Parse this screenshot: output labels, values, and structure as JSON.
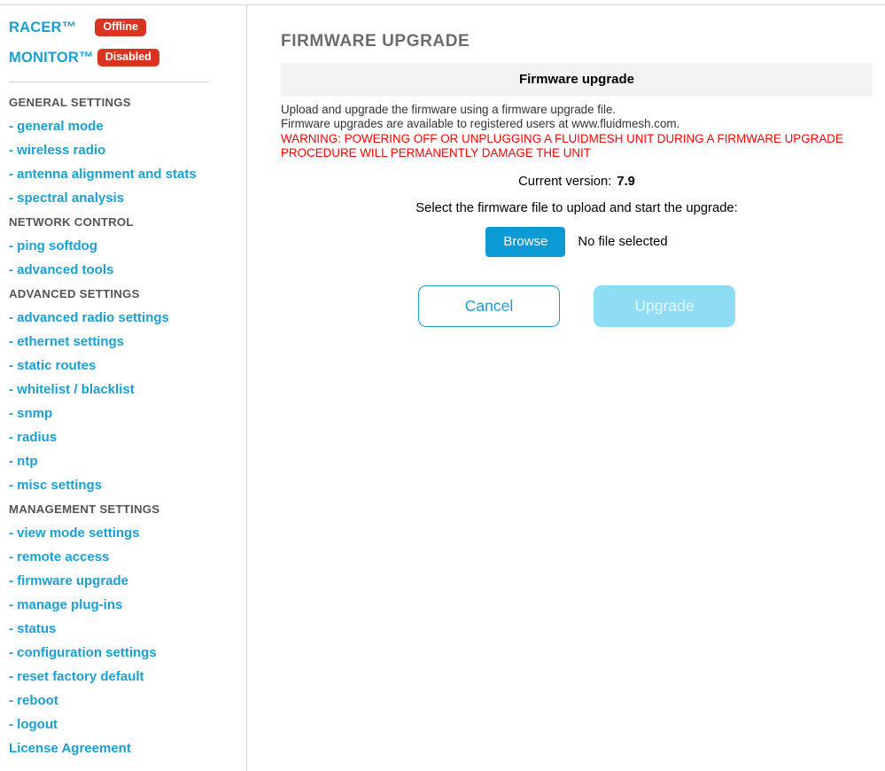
{
  "sidebar": {
    "brands": [
      {
        "name": "RACER™",
        "badge": "Offline"
      },
      {
        "name": "MONITOR™",
        "badge": "Disabled"
      }
    ],
    "sections": [
      {
        "title": "GENERAL SETTINGS",
        "items": [
          "- general mode",
          "- wireless radio",
          "- antenna alignment and stats",
          "- spectral analysis"
        ]
      },
      {
        "title": "NETWORK CONTROL",
        "items": [
          "- ping softdog",
          "- advanced tools"
        ]
      },
      {
        "title": "ADVANCED SETTINGS",
        "items": [
          "- advanced radio settings",
          "- ethernet settings",
          "- static routes",
          "- whitelist / blacklist",
          "- snmp",
          "- radius",
          "- ntp",
          "- misc settings"
        ]
      },
      {
        "title": "MANAGEMENT SETTINGS",
        "items": [
          "- view mode settings",
          "- remote access",
          "- firmware upgrade",
          "- manage plug-ins",
          "- status",
          "- configuration settings",
          "- reset factory default",
          "- reboot",
          "- logout"
        ]
      }
    ],
    "license_link": "License Agreement"
  },
  "main": {
    "page_title": "FIRMWARE UPGRADE",
    "panel_header": "Firmware upgrade",
    "description_line_1": "Upload and upgrade the firmware using a firmware upgrade file.",
    "description_line_2": "Firmware upgrades are available to registered users at www.fluidmesh.com.",
    "warning_line_1": "WARNING: POWERING OFF OR UNPLUGGING A FLUIDMESH UNIT DURING A FIRMWARE UPGRADE",
    "warning_line_2": "PROCEDURE WILL PERMANENTLY DAMAGE THE UNIT",
    "current_version_label": "Current version:",
    "current_version_value": "7.9",
    "select_instruction": "Select the firmware file to upload and start the upgrade:",
    "browse_label": "Browse",
    "file_status": "No file selected",
    "cancel_label": "Cancel",
    "upgrade_label": "Upgrade"
  },
  "colors": {
    "link_blue": "#1a9fd4",
    "badge_red": "#d8341f",
    "browse_blue": "#0c9ad4",
    "upgrade_disabled": "#8fdcf5",
    "warning_red": "#ff0000",
    "section_gray": "#555555",
    "panel_header_bg": "#f3f3f3"
  }
}
